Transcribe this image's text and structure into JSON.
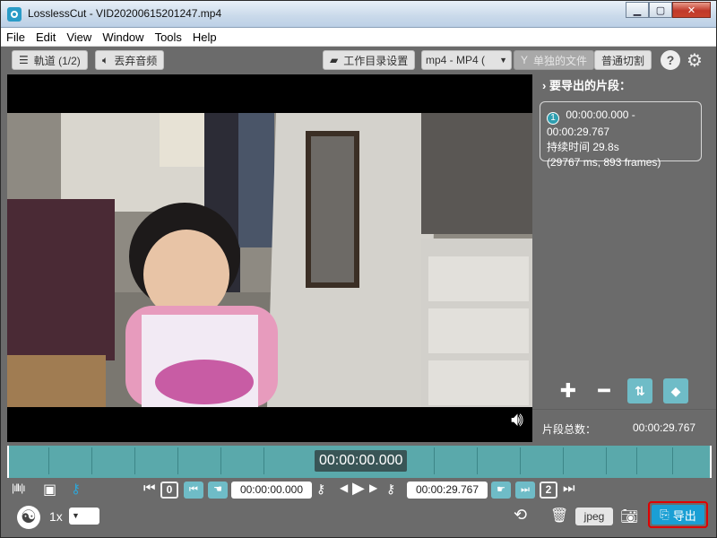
{
  "window": {
    "title": "LosslessCut - VID20200615201247.mp4",
    "buttons": {
      "minimize": "▁",
      "maximize": "▢",
      "close": "✕"
    }
  },
  "menu": [
    "File",
    "Edit",
    "View",
    "Window",
    "Tools",
    "Help"
  ],
  "toolbar": {
    "tracks_label": "軌道 (1/2)",
    "discard_audio_label": "丟弃音频",
    "workdir_label": "工作目录设置",
    "format_select": "mp4 - MP4 (",
    "separate_files_label": "单独的文件",
    "cut_mode_label": "普通切割",
    "help_icon_text": "?"
  },
  "segments": {
    "header": "要导出的片段：",
    "items": [
      {
        "number": "1",
        "range": "00:00:00.000 - 00:00:29.767",
        "duration": "持续时间 29.8s",
        "detail": "(29767 ms, 893 frames)"
      }
    ],
    "total_label": "片段总数：",
    "total_value": "00:00:29.767"
  },
  "timeline": {
    "current_time": "00:00:00.000"
  },
  "controls": {
    "start_badge": "0",
    "start_time": "00:00:00.000",
    "end_time": "00:00:29.767",
    "end_badge": "2",
    "speed": "1x",
    "capture_format": "jpeg",
    "export_label": "导出"
  },
  "colors": {
    "accent_teal": "#6fbcc7",
    "timeline": "#5aa9ab",
    "export_blue": "#1a9fd4",
    "highlight_red": "#e00000"
  }
}
